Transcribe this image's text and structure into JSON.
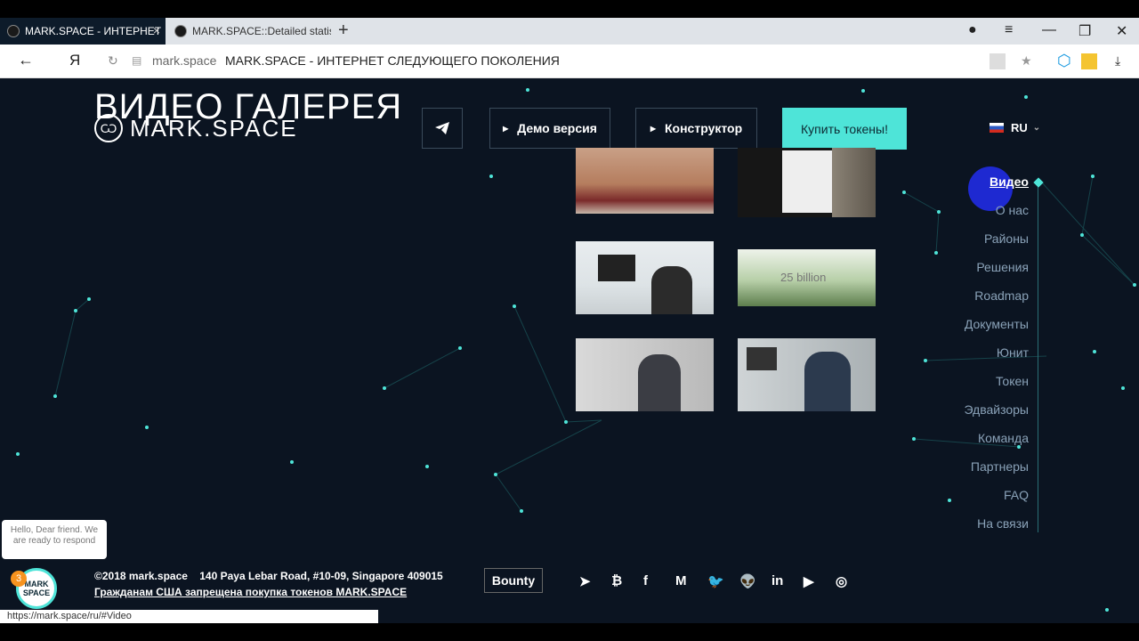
{
  "browser": {
    "tabs": [
      {
        "title": "MARK.SPACE - ИНТЕРНЕТ",
        "active": true,
        "close": "×"
      },
      {
        "title": "MARK.SPACE::Detailed statis",
        "active": false
      }
    ],
    "new_tab": "+",
    "window_controls": {
      "menu": "≡",
      "minimize": "—",
      "restore": "❐",
      "close": "✕"
    },
    "address": {
      "back": "←",
      "yandex_logo": "Я",
      "reload": "↻",
      "domain": "mark.space",
      "page_title": "MARK.SPACE - ИНТЕРНЕТ СЛЕДУЮЩЕГО ПОКОЛЕНИЯ",
      "bookmark": "★",
      "download": "⤓"
    }
  },
  "page": {
    "heading": "ВИДЕО ГАЛЕРЕЯ",
    "logo_text": "MARK.SPACE",
    "buttons": {
      "telegram_icon": "telegram-icon",
      "demo": "Демо версия",
      "constructor": "Конструктор",
      "buy": "Купить токены!"
    },
    "language": "RU",
    "thumbnail_4_text": "25 billion",
    "side_nav": [
      {
        "label": "Видео",
        "active": true
      },
      {
        "label": "О нас"
      },
      {
        "label": "Районы"
      },
      {
        "label": "Решения"
      },
      {
        "label": "Roadmap"
      },
      {
        "label": "Документы"
      },
      {
        "label": "Юнит"
      },
      {
        "label": "Токен"
      },
      {
        "label": "Эдвайзоры"
      },
      {
        "label": "Команда"
      },
      {
        "label": "Партнеры"
      },
      {
        "label": "FAQ"
      },
      {
        "label": "На связи"
      }
    ],
    "chat": {
      "bubble": "Hello, Dear friend. We are ready to respond",
      "badge": "3",
      "logo": "MARK SPACE"
    },
    "footer": {
      "copyright": "©2018 mark.space    140 Paya Lebar Road, #10-09, Singapore 409015",
      "warning": "Гражданам США запрещена покупка токенов MARK.SPACE",
      "bounty": "Bounty",
      "socials": [
        "telegram-icon",
        "bitcoin-icon",
        "facebook-icon",
        "medium-icon",
        "twitter-icon",
        "reddit-icon",
        "linkedin-icon",
        "youtube-icon",
        "instagram-icon"
      ]
    },
    "status_url": "https://mark.space/ru/#Video"
  },
  "colors": {
    "accent": "#4ee4d8",
    "background": "#0b1421"
  }
}
